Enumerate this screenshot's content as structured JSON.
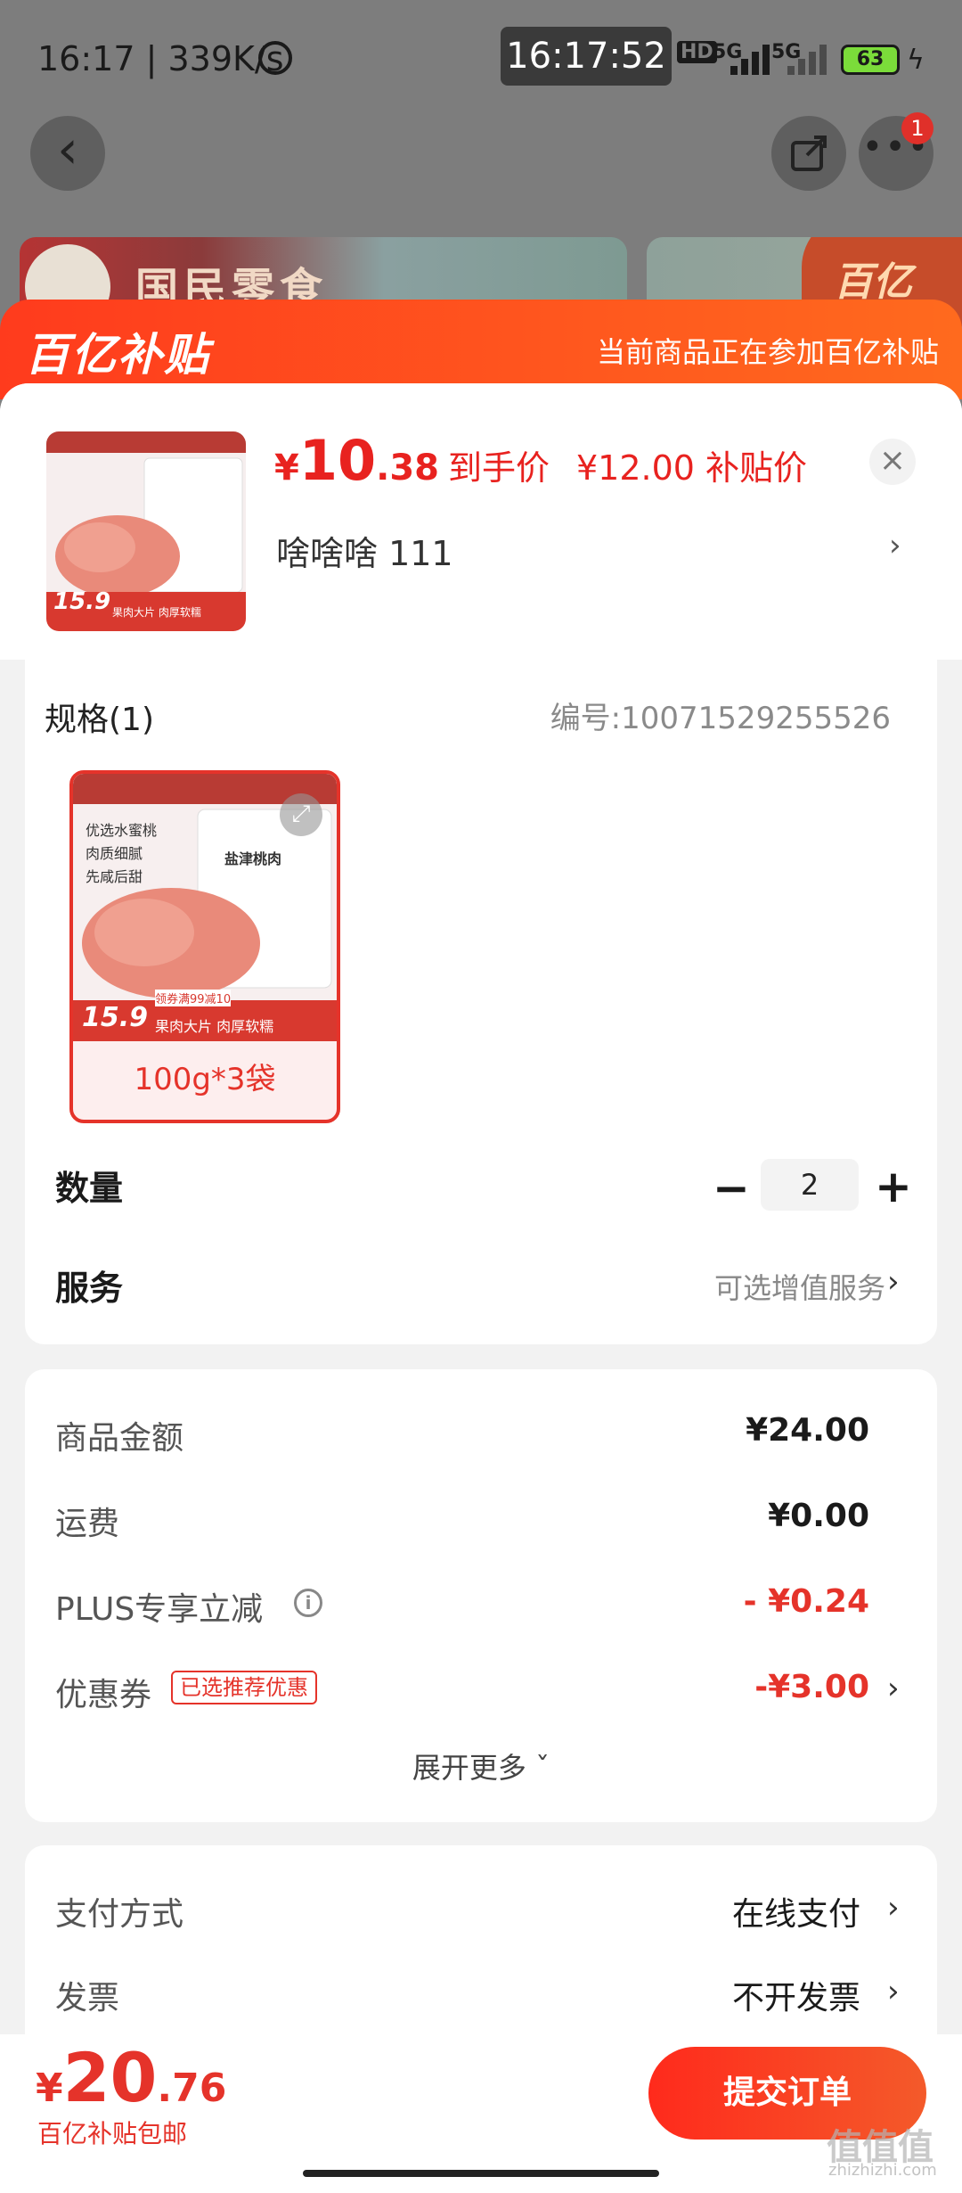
{
  "status_bar": {
    "time": "16:17 | 339K/s",
    "recording_clock": "16:17:52",
    "net1": "5G",
    "net2": "5G",
    "hd": "HD",
    "battery": "63"
  },
  "header": {
    "more_badge": "1"
  },
  "banner": {
    "brand_text": "国民零食",
    "corner_text": "百亿"
  },
  "subsidy": {
    "logo": "百亿补贴",
    "note": "当前商品正在参加百亿补贴"
  },
  "product": {
    "price_symbol": "¥",
    "price_int": "10",
    "price_dec": ".38",
    "price_label": "到手价",
    "subsidy_price": "¥12.00 补贴价",
    "address": "啥啥啥  111",
    "thumb_badge": "15.9",
    "thumb_tag": "果肉大片 肉厚软糯"
  },
  "spec": {
    "title": "规格(1)",
    "code": "编号:10071529255526",
    "option_label": "100g*3袋",
    "option_selected": true,
    "image_texts": [
      "优选水蜜桃",
      "肉质细腻",
      "先咸后甜",
      "盐津桃肉",
      "领券满99减10",
      "果肉大片 肉厚软糯",
      "15.9"
    ]
  },
  "quantity": {
    "label": "数量",
    "value": "2",
    "minus": "−",
    "plus": "+"
  },
  "service": {
    "label": "服务",
    "hint": "可选增值服务"
  },
  "pricing": {
    "goods_label": "商品金额",
    "goods_value": "¥24.00",
    "shipping_label": "运费",
    "shipping_value": "¥0.00",
    "plus_label": "PLUS专享立减",
    "plus_value": "- ¥0.24",
    "coupon_label": "优惠券",
    "coupon_tag": "已选推荐优惠",
    "coupon_value": "-¥3.00",
    "expand_more": "展开更多 ˇ"
  },
  "payment": {
    "method_label": "支付方式",
    "method_value": "在线支付",
    "invoice_label": "发票",
    "invoice_value": "不开发票"
  },
  "footer": {
    "total_symbol": "¥",
    "total_int": "20",
    "total_dec": ".76",
    "total_note": "百亿补贴包邮",
    "submit_label": "提交订单",
    "watermark": "值值值",
    "watermark_sub": "zhizhizhi.com"
  },
  "colors": {
    "accent": "#e5332a",
    "subsidy_orange": "#ff4a1d"
  }
}
